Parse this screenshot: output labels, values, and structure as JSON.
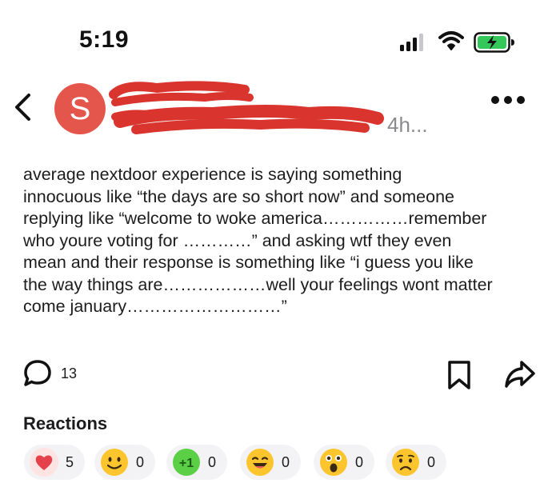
{
  "status_bar": {
    "time": "5:19",
    "icons": [
      "signal-icon",
      "wifi-icon",
      "battery-charging-icon"
    ],
    "battery_color": "#34c759"
  },
  "header": {
    "avatar_initial": "S",
    "avatar_color": "#e4564b",
    "author_name": "[redacted]",
    "subtitle": "[redacted]",
    "post_age": "4h...",
    "icons": [
      "back-icon",
      "more-icon"
    ]
  },
  "post": {
    "body": "average nextdoor experience is saying something\ninnocuous like “the days are so short now” and someone\nreplying like “welcome to woke america……………remember\nwho youre voting for …………”  and asking wtf they even\nmean and their response is something like “i guess you like\nthe way things are………………well your feelings wont matter\ncome january………………………”"
  },
  "actions": {
    "comment_count": "13",
    "icons": [
      "comment-icon",
      "bookmark-icon",
      "share-icon"
    ]
  },
  "reactions": {
    "title": "Reactions",
    "items": [
      {
        "name": "heart-icon",
        "count": "5"
      },
      {
        "name": "smile-emoji-icon",
        "count": "0"
      },
      {
        "name": "plus-one-icon",
        "count": "0"
      },
      {
        "name": "laugh-emoji-icon",
        "count": "0"
      },
      {
        "name": "surprised-emoji-icon",
        "count": "0"
      },
      {
        "name": "sad-emoji-icon",
        "count": "0"
      }
    ]
  }
}
